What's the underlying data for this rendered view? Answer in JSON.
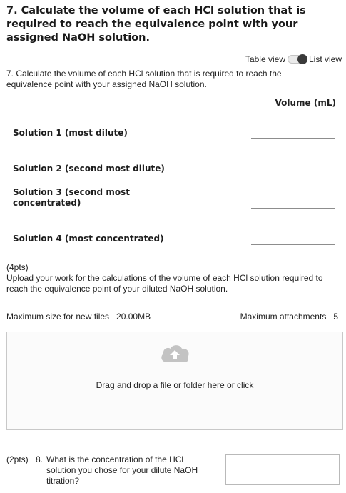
{
  "question": {
    "title": "7. Calculate the volume of each HCl solution that is required to reach the equivalence point with your assigned NaOH solution."
  },
  "view_toggle": {
    "table_label": "Table view",
    "list_label": "List view"
  },
  "table": {
    "caption": "7. Calculate the volume of each HCl solution that is required to reach the equivalence point with your assigned NaOH solution.",
    "column_header": "Volume (mL)",
    "rows": [
      {
        "label": "Solution 1 (most dilute)",
        "value": ""
      },
      {
        "label": "Solution 2 (second most dilute)",
        "value": ""
      },
      {
        "label": "Solution 3 (second most concentrated)",
        "value": ""
      },
      {
        "label": "Solution 4 (most concentrated)",
        "value": ""
      }
    ]
  },
  "upload": {
    "points": "(4pts)",
    "prompt": "Upload your work for the calculations of the volume of each HCl solution required to reach the equivalence point of your diluted NaOH solution.",
    "max_size_label": "Maximum size for new files",
    "max_size_value": "20.00MB",
    "max_attachments_label": "Maximum attachments",
    "max_attachments_value": "5",
    "drop_text": "Drag and drop a file or folder here or click",
    "icon": "cloud-upload-icon"
  },
  "question8": {
    "points": "(2pts)",
    "number": "8.",
    "text": "What is the concentration of the HCl solution you chose for your dilute NaOH titration?",
    "value": ""
  }
}
